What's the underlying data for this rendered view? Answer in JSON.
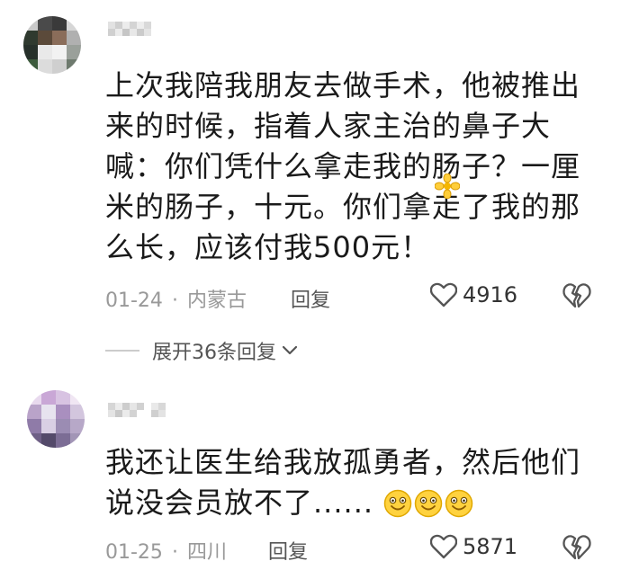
{
  "comments": [
    {
      "username": "用户",
      "lines": [
        "上次我陪我朋友去做手术，他被推出",
        "来的时候，指着人家主治的鼻子大",
        "喊：你们凭什么拿走我的肠子？一厘",
        "米的肠子，十元。你们拿走了我的那",
        "么长，应该付我500元！"
      ],
      "date": "01-24",
      "separator": "·",
      "location": "内蒙古",
      "reply_label": "回复",
      "likes": "4916"
    },
    {
      "username": "用户",
      "lines": [
        "我还让医生给我放孤勇者，然后他们",
        "说没会员放不了......"
      ],
      "emojis": [
        "smile-emoji",
        "smile-emoji",
        "smile-emoji"
      ],
      "date": "01-25",
      "separator": "·",
      "location": "四川",
      "reply_label": "回复",
      "likes": "5871"
    }
  ],
  "expand_replies": {
    "label": "展开36条回复",
    "icon": "chevron-down-icon"
  },
  "icons": {
    "like": "heart-outline-icon",
    "dislike": "broken-heart-icon"
  },
  "colors": {
    "text": "#1a1a1a",
    "meta": "#999999",
    "secondary": "#555555",
    "emoji_face": "#FFD23F"
  }
}
